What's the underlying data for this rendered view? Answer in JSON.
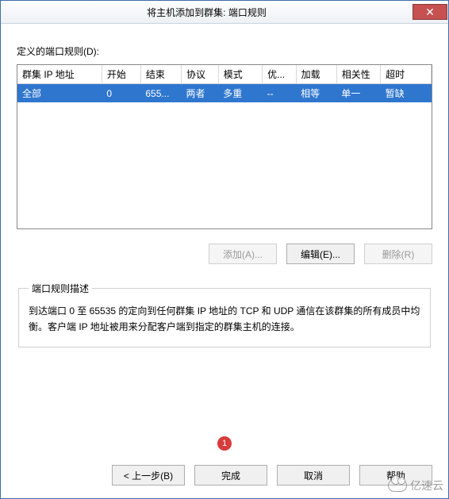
{
  "window": {
    "title": "将主机添加到群集: 端口规则"
  },
  "labels": {
    "defined_rules": "定义的端口规则(D):",
    "desc_legend": "端口规则描述",
    "desc_text": "到达端口 0 至 65535 的定向到任何群集 IP 地址的 TCP 和 UDP 通信在该群集的所有成员中均衡。客户端 IP 地址被用来分配客户端到指定的群集主机的连接。"
  },
  "grid": {
    "headers": {
      "cluster_ip": "群集 IP 地址",
      "start": "开始",
      "end": "结束",
      "protocol": "协议",
      "mode": "模式",
      "priority": "优...",
      "load": "加载",
      "affinity": "相关性",
      "timeout": "超时"
    },
    "row": {
      "cluster_ip": "全部",
      "start": "0",
      "end": "655...",
      "protocol": "两者",
      "mode": "多重",
      "priority": "--",
      "load": "相等",
      "affinity": "单一",
      "timeout": "暂缺"
    }
  },
  "buttons": {
    "add": "添加(A)...",
    "edit": "编辑(E)...",
    "remove": "删除(R)",
    "back": "< 上一步(B)",
    "finish": "完成",
    "cancel": "取消",
    "help": "帮助"
  },
  "annotation": {
    "badge": "1"
  },
  "watermark": {
    "text": "亿速云"
  }
}
